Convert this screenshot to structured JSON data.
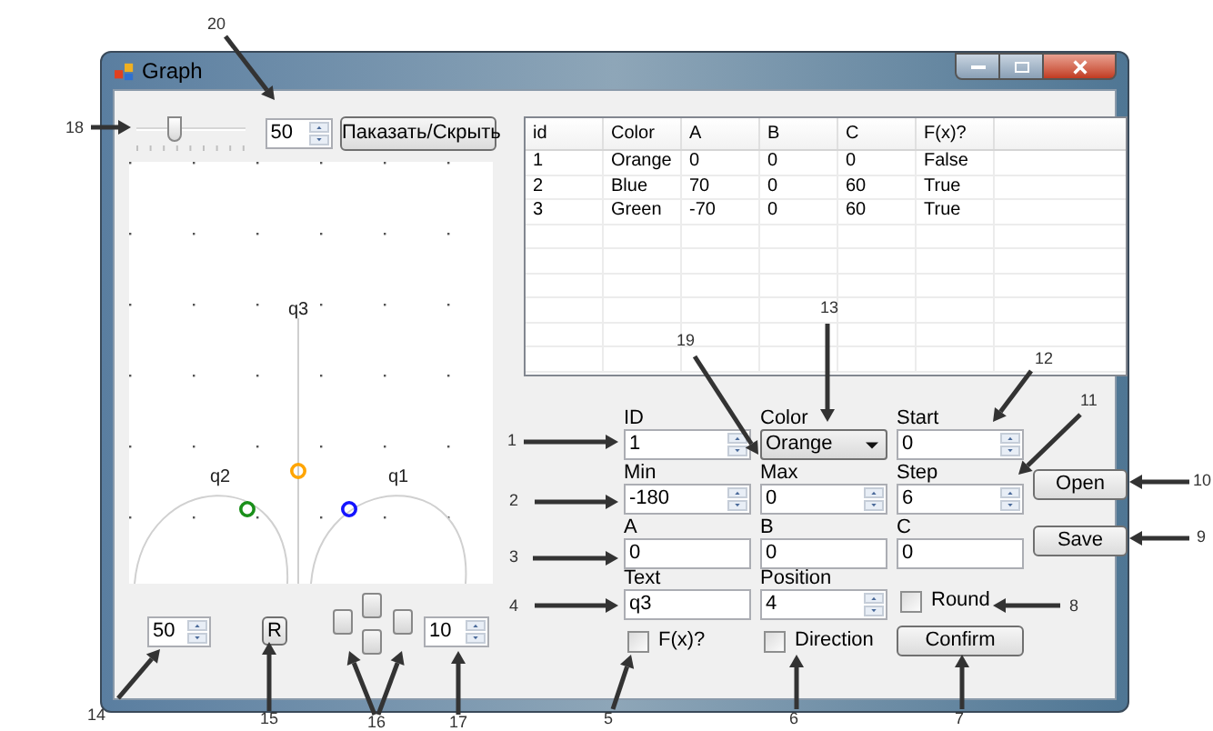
{
  "window": {
    "title": "Graph"
  },
  "toolbar": {
    "slider": {
      "level": 0.35
    },
    "size_value": "50",
    "toggle_button": "Паказать/Скрыть"
  },
  "canvas": {
    "points": [
      {
        "label": "q3",
        "color": "#ffa500"
      },
      {
        "label": "q2",
        "color": "#1a8f1a"
      },
      {
        "label": "q1",
        "color": "#1414ff"
      }
    ]
  },
  "canvas_controls": {
    "zoom_value": "50",
    "reset_button": "R",
    "step_value": "10"
  },
  "table": {
    "columns": [
      "id",
      "Color",
      "A",
      "B",
      "C",
      "F(x)?"
    ],
    "rows": [
      [
        "1",
        "Orange",
        "0",
        "0",
        "0",
        "False"
      ],
      [
        "2",
        "Blue",
        "70",
        "0",
        "60",
        "True"
      ],
      [
        "3",
        "Green",
        "-70",
        "0",
        "60",
        "True"
      ]
    ]
  },
  "form": {
    "fields": [
      {
        "kind": "spin",
        "label": "ID",
        "value": "1"
      },
      {
        "kind": "combo",
        "label": "Color",
        "value": "Orange"
      },
      {
        "kind": "spin",
        "label": "Start",
        "value": "0"
      },
      {
        "kind": "spin",
        "label": "Min",
        "value": "-180"
      },
      {
        "kind": "spin",
        "label": "Max",
        "value": "0"
      },
      {
        "kind": "spin",
        "label": "Step",
        "value": "6"
      },
      {
        "kind": "text",
        "label": "A",
        "value": "0"
      },
      {
        "kind": "text",
        "label": "B",
        "value": "0"
      },
      {
        "kind": "text",
        "label": "C",
        "value": "0"
      },
      {
        "kind": "text",
        "label": "Text",
        "value": "q3"
      },
      {
        "kind": "spin",
        "label": "Position",
        "value": "4"
      },
      {
        "kind": "checkbox",
        "label": "Round",
        "checked": false
      },
      {
        "kind": "checkbox",
        "label": "F(x)?",
        "checked": false
      },
      {
        "kind": "checkbox",
        "label": "Direction",
        "checked": false
      },
      {
        "kind": "button",
        "label": "Confirm"
      }
    ],
    "side_buttons": [
      "Open",
      "Save"
    ]
  },
  "callouts": [
    {
      "number": "20"
    },
    {
      "number": "18"
    },
    {
      "number": "13"
    },
    {
      "number": "19"
    },
    {
      "number": "12"
    },
    {
      "number": "11"
    },
    {
      "number": "1"
    },
    {
      "number": "10"
    },
    {
      "number": "2"
    },
    {
      "number": "9"
    },
    {
      "number": "3"
    },
    {
      "number": "4"
    },
    {
      "number": "8"
    },
    {
      "number": "14"
    },
    {
      "number": "15"
    },
    {
      "number": "16"
    },
    {
      "number": "17"
    },
    {
      "number": "5"
    },
    {
      "number": "6"
    },
    {
      "number": "7"
    }
  ]
}
